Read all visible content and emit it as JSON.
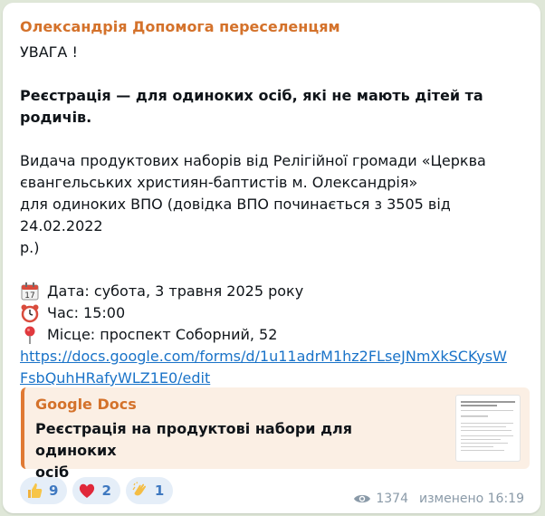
{
  "channel": {
    "name": "Олександрія Допомога переселенцям"
  },
  "message": {
    "attention": "УВАГА !",
    "registration_line1": "Реєстрація — для одиноких осіб, які не мають дітей та",
    "registration_line2": "родичів.",
    "body_line1": "Видача продуктових наборів від Релігійної громади «Церква",
    "body_line2": "євангельських християн-баптистів м. Олександрія»",
    "body_line3": "для одиноких ВПО (довідка ВПО починається з 3505 від 24.02.2022",
    "body_line4": "р.)",
    "date": "Дата: субота, 3 травня 2025 року",
    "time": "Час: 15:00",
    "place": "Місце: проспект Соборний, 52",
    "link_line1": "https://docs.google.com/forms/d/1u11adrM1hz2FLseJNmXkSCKysW",
    "link_line2": "FsbQuhHRafyWLZ1E0/edit",
    "icons": [
      "calendar-icon",
      "alarm-clock-icon",
      "pin-icon"
    ]
  },
  "preview": {
    "site": "Google Docs",
    "title_line1": "Реєстрація на продуктові набори для одиноких",
    "title_line2": "осіб"
  },
  "reactions": [
    {
      "icon": "thumbs-up-icon",
      "count": "9"
    },
    {
      "icon": "heart-icon",
      "count": "2"
    },
    {
      "icon": "clapping-hands-icon",
      "count": "1"
    }
  ],
  "meta": {
    "views": "1374",
    "edited": "изменено 16:19"
  },
  "colors": {
    "accent": "#d4722b",
    "link": "#1a73c8",
    "reaction_bg": "#e5eef8"
  }
}
